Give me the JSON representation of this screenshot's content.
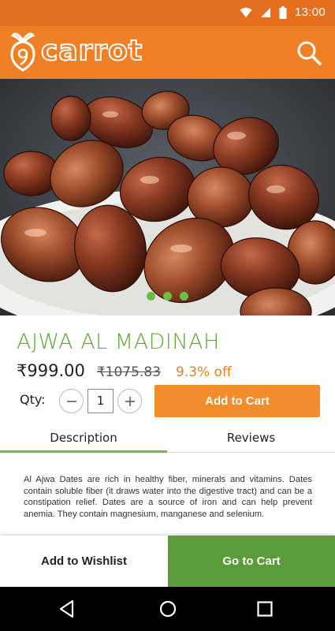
{
  "status_bar": {
    "time": "13:00"
  },
  "app_bar": {
    "logo_text": "carrot"
  },
  "product": {
    "title": "AJWA AL MADINAH",
    "price": "₹999.00",
    "mrp": "₹1075.83",
    "discount": "9.3% off",
    "image_dots": 3,
    "active_dot": 1
  },
  "quantity": {
    "label": "Qty:",
    "value": "1"
  },
  "buttons": {
    "add_to_cart": "Add to Cart",
    "add_to_wishlist": "Add to Wishlist",
    "go_to_cart": "Go to Cart"
  },
  "tabs": [
    {
      "label": "Description",
      "active": true
    },
    {
      "label": "Reviews",
      "active": false
    }
  ],
  "description": "Al Ajwa Dates are rich in healthy fiber, minerals and vitamins. Dates contain soluble fiber (it draws water into the digestive tract) and can be a constipation relief. Dates are a source of iron and can help prevent anemia. They contain magnesium, manganese and selenium.",
  "colors": {
    "brand_orange": "#f07f26",
    "status_orange": "#e4701f",
    "accent_green": "#6cbd45",
    "cart_green": "#5a9c3a"
  },
  "icons": [
    "wifi-icon",
    "signal-icon",
    "battery-icon",
    "carrot-logo-icon",
    "search-icon",
    "back-icon",
    "home-icon",
    "recents-icon"
  ]
}
